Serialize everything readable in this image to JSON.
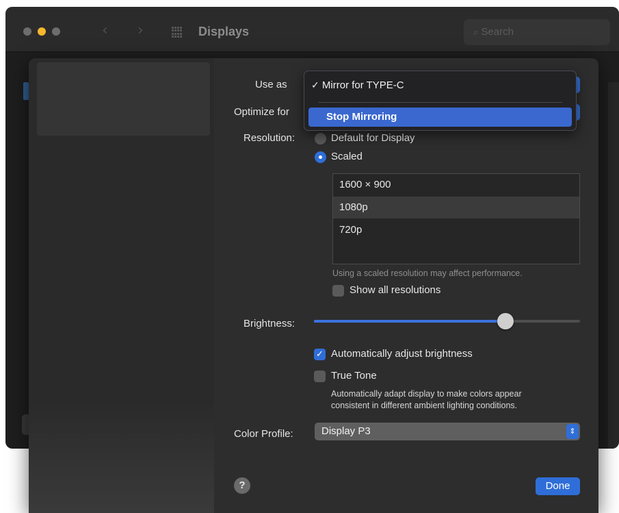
{
  "window": {
    "title": "Displays",
    "search_placeholder": "Search"
  },
  "labels": {
    "use_as": "Use as",
    "optimize_for": "Optimize for",
    "resolution": "Resolution:",
    "brightness": "Brightness:",
    "color_profile": "Color Profile:"
  },
  "use_as_menu": {
    "items": [
      {
        "label": "Mirror for TYPE-C",
        "checked": true
      },
      {
        "label": "Stop Mirroring",
        "highlighted": true
      }
    ]
  },
  "resolution": {
    "options": [
      {
        "label": "Default for Display",
        "selected": false
      },
      {
        "label": "Scaled",
        "selected": true
      }
    ],
    "list": [
      {
        "label": "1600 × 900",
        "selected": false
      },
      {
        "label": "1080p",
        "selected": true
      },
      {
        "label": "720p",
        "selected": false
      }
    ],
    "note": "Using a scaled resolution may affect performance.",
    "show_all_label": "Show all resolutions",
    "show_all_checked": false
  },
  "brightness": {
    "value": 0.72,
    "auto_adjust_label": "Automatically adjust brightness",
    "auto_adjust_checked": true,
    "true_tone_label": "True Tone",
    "true_tone_checked": false,
    "true_tone_note_line1": "Automatically adapt display to make colors appear",
    "true_tone_note_line2": "consistent in different ambient lighting conditions."
  },
  "color_profile": {
    "value": "Display P3"
  },
  "buttons": {
    "help": "?",
    "done": "Done"
  },
  "colors": {
    "accent": "#2f6ed8",
    "highlight": "#3a68cf"
  }
}
